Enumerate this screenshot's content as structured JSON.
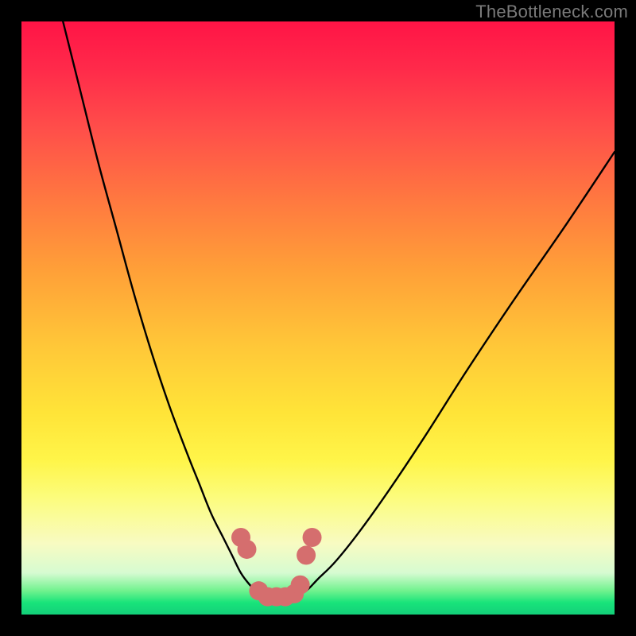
{
  "watermark": "TheBottleneck.com",
  "chart_data": {
    "type": "line",
    "title": "",
    "xlabel": "",
    "ylabel": "",
    "xlim": [
      0,
      100
    ],
    "ylim": [
      0,
      100
    ],
    "series": [
      {
        "name": "left-curve",
        "x": [
          7,
          10,
          13,
          16,
          19,
          22,
          25,
          28,
          30,
          32,
          34,
          35.5,
          37,
          38.5,
          40,
          41
        ],
        "values": [
          100,
          88,
          76,
          65,
          54,
          44,
          35,
          27,
          22,
          17,
          13,
          10,
          7,
          5,
          3.5,
          3
        ]
      },
      {
        "name": "right-curve",
        "x": [
          46,
          48,
          50,
          53,
          57,
          62,
          68,
          75,
          83,
          92,
          100
        ],
        "values": [
          3,
          4,
          6,
          9,
          14,
          21,
          30,
          41,
          53,
          66,
          78
        ]
      },
      {
        "name": "markers",
        "x": [
          37,
          38,
          40,
          41.5,
          43,
          44.5,
          46,
          47,
          48,
          49
        ],
        "values": [
          13,
          11,
          4,
          3,
          3,
          3,
          3.5,
          5,
          10,
          13
        ]
      }
    ],
    "colors": {
      "curve": "#000000",
      "marker": "#d56e6e",
      "gradient_top": "#ff1446",
      "gradient_bottom": "#13cf79",
      "frame": "#000000"
    }
  }
}
